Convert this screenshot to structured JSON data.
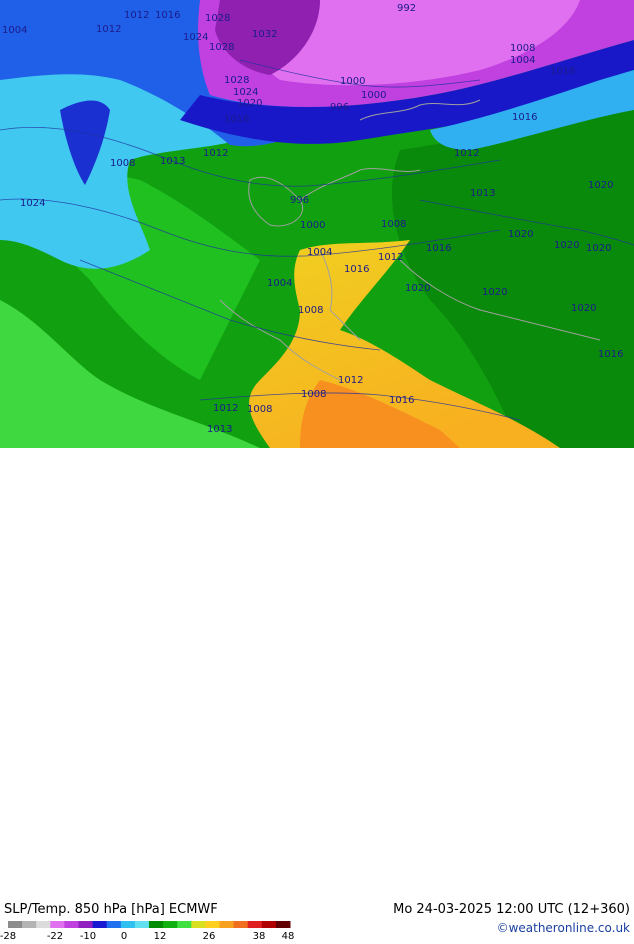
{
  "header": {
    "title": "SLP/Temp. 850 hPa [hPa] ECMWF",
    "valid_time": "Mo 24-03-2025 12:00 UTC (12+360)",
    "credit": "©weatheronline.co.uk"
  },
  "legend": {
    "ticks": [
      "-28",
      "-22",
      "-10",
      "0",
      "12",
      "26",
      "38",
      "48"
    ],
    "colors": [
      "#8c8c8c",
      "#b4b4b4",
      "#dcdcdc",
      "#e070f0",
      "#c040e0",
      "#9020c0",
      "#1a1ad0",
      "#2070f0",
      "#30c0f0",
      "#60e0f0",
      "#008c00",
      "#10b010",
      "#40e040",
      "#d8e020",
      "#ffd020",
      "#f8a020",
      "#f07020",
      "#e02020",
      "#b00000",
      "#600000"
    ]
  },
  "isobars": [
    {
      "text": "1004"
    },
    {
      "text": "1012"
    },
    {
      "text": "1012"
    },
    {
      "text": "1016"
    },
    {
      "text": "1028"
    },
    {
      "text": "1024"
    },
    {
      "text": "1032"
    },
    {
      "text": "1028"
    },
    {
      "text": "992"
    },
    {
      "text": "1008"
    },
    {
      "text": "1004"
    },
    {
      "text": "1016"
    },
    {
      "text": "1028"
    },
    {
      "text": "1024"
    },
    {
      "text": "1020"
    },
    {
      "text": "1016"
    },
    {
      "text": "1000"
    },
    {
      "text": "1000"
    },
    {
      "text": "996"
    },
    {
      "text": "1016"
    },
    {
      "text": "1008"
    },
    {
      "text": "1013"
    },
    {
      "text": "1012"
    },
    {
      "text": "1012"
    },
    {
      "text": "1024"
    },
    {
      "text": "996"
    },
    {
      "text": "1000"
    },
    {
      "text": "1008"
    },
    {
      "text": "1013"
    },
    {
      "text": "1020"
    },
    {
      "text": "1004"
    },
    {
      "text": "1012"
    },
    {
      "text": "1016"
    },
    {
      "text": "1016"
    },
    {
      "text": "1020"
    },
    {
      "text": "1020"
    },
    {
      "text": "1020"
    },
    {
      "text": "1004"
    },
    {
      "text": "1020"
    },
    {
      "text": "1020"
    },
    {
      "text": "1008"
    },
    {
      "text": "1020"
    },
    {
      "text": "1016"
    },
    {
      "text": "1012"
    },
    {
      "text": "1008"
    },
    {
      "text": "1016"
    },
    {
      "text": "1012"
    },
    {
      "text": "1008"
    },
    {
      "text": "1013"
    }
  ]
}
